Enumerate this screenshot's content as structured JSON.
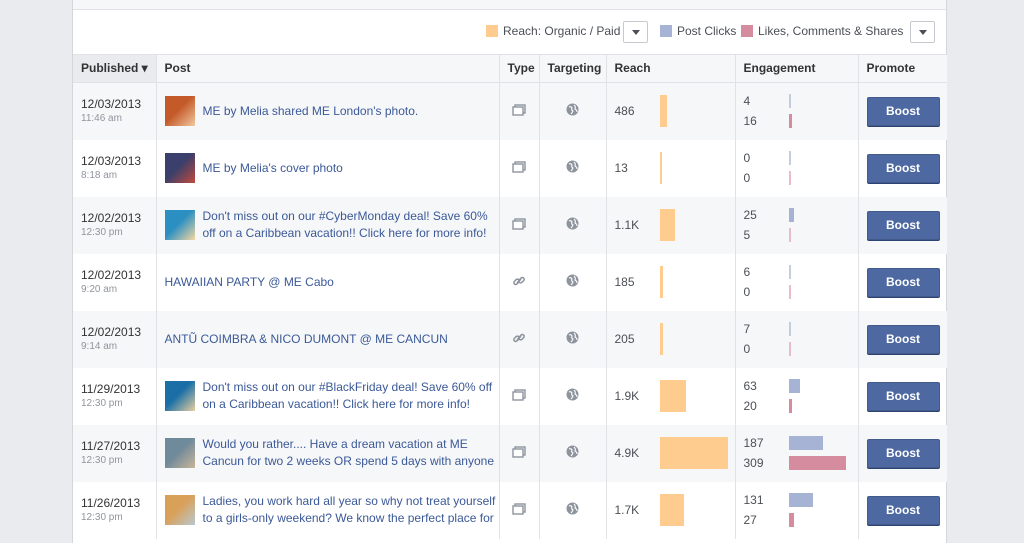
{
  "colors": {
    "reach": "#ffcc8f",
    "post_clicks": "#a6b3d4",
    "likes": "#d48c9e",
    "link": "#3b5998",
    "boost_bg": "#4e69a2"
  },
  "legend": {
    "reach_label": "Reach: Organic / Paid",
    "post_clicks_label": "Post Clicks",
    "likes_label": "Likes, Comments & Shares"
  },
  "table": {
    "headers": {
      "published": "Published ▾",
      "post": "Post",
      "type": "Type",
      "targeting": "Targeting",
      "reach": "Reach",
      "engagement": "Engagement",
      "promote": "Promote"
    },
    "rows": [
      {
        "date": "12/03/2013",
        "time": "11:46 am",
        "thumb": "photo-thumb",
        "post": "ME by Melia shared ME London's photo.",
        "type_icon": "photo-icon",
        "reach": "486",
        "reach_frac": 0.1,
        "clicks": "4",
        "likes": "16",
        "clicks_frac": 0.02,
        "likes_frac": 0.05,
        "boost": "Boost"
      },
      {
        "date": "12/03/2013",
        "time": "8:18 am",
        "thumb": "photo-thumb",
        "post": "ME by Melia's cover photo",
        "type_icon": "photo-icon",
        "reach": "13",
        "reach_frac": 0.0,
        "clicks": "0",
        "likes": "0",
        "clicks_frac": 0,
        "likes_frac": 0,
        "boost": "Boost"
      },
      {
        "date": "12/02/2013",
        "time": "12:30 pm",
        "thumb": "photo-thumb",
        "post": "Don't miss out on our #CyberMonday deal! Save 60% off on a Caribbean vacation!! Click here for more info!",
        "type_icon": "photo-icon",
        "reach": "1.1K",
        "reach_frac": 0.22,
        "clicks": "25",
        "likes": "5",
        "clicks_frac": 0.08,
        "likes_frac": 0.02,
        "boost": "Boost"
      },
      {
        "date": "12/02/2013",
        "time": "9:20 am",
        "thumb": "",
        "post": "HAWAIIAN PARTY @ ME Cabo",
        "type_icon": "link-icon",
        "reach": "185",
        "reach_frac": 0.04,
        "clicks": "6",
        "likes": "0",
        "clicks_frac": 0.02,
        "likes_frac": 0,
        "boost": "Boost"
      },
      {
        "date": "12/02/2013",
        "time": "9:14 am",
        "thumb": "",
        "post": "ANTŨ COIMBRA & NICO DUMONT @ ME CANCUN",
        "type_icon": "link-icon",
        "reach": "205",
        "reach_frac": 0.04,
        "clicks": "7",
        "likes": "0",
        "clicks_frac": 0.02,
        "likes_frac": 0,
        "boost": "Boost"
      },
      {
        "date": "11/29/2013",
        "time": "12:30 pm",
        "thumb": "photo-thumb",
        "post": "Don't miss out on our #BlackFriday deal! Save 60% off on a Caribbean vacation!! Click here for more info!",
        "type_icon": "photo-icon",
        "reach": "1.9K",
        "reach_frac": 0.38,
        "clicks": "63",
        "likes": "20",
        "clicks_frac": 0.2,
        "likes_frac": 0.06,
        "boost": "Boost"
      },
      {
        "date": "11/27/2013",
        "time": "12:30 pm",
        "thumb": "photo-thumb",
        "post": "Would you rather.... Have a dream vacation at ME Cancun for two 2 weeks OR spend 5 days with anyone",
        "type_icon": "photo-icon",
        "reach": "4.9K",
        "reach_frac": 1.0,
        "clicks": "187",
        "likes": "309",
        "clicks_frac": 0.6,
        "likes_frac": 1.0,
        "boost": "Boost"
      },
      {
        "date": "11/26/2013",
        "time": "12:30 pm",
        "thumb": "photo-thumb",
        "post": "Ladies, you work hard all year so why not treat yourself to a girls-only weekend? We know the perfect place for",
        "type_icon": "photo-icon",
        "reach": "1.7K",
        "reach_frac": 0.35,
        "clicks": "131",
        "likes": "27",
        "clicks_frac": 0.42,
        "likes_frac": 0.09,
        "boost": "Boost"
      }
    ]
  }
}
